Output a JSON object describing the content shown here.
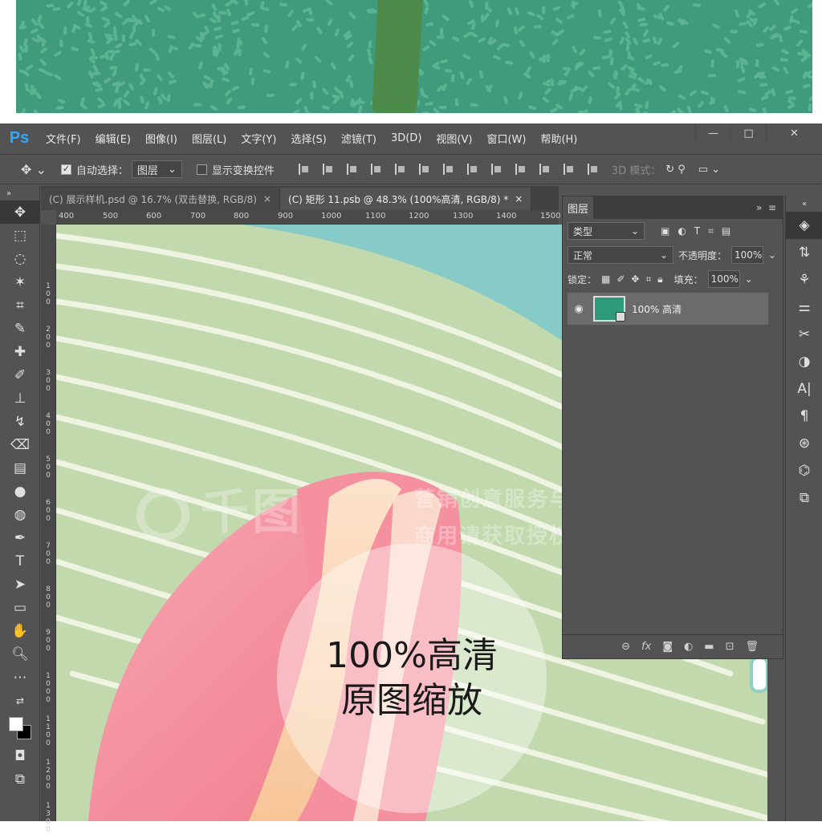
{
  "app": {
    "logo": "Ps"
  },
  "menu": [
    "文件(F)",
    "编辑(E)",
    "图像(I)",
    "图层(L)",
    "文字(Y)",
    "选择(S)",
    "滤镜(T)",
    "3D(D)",
    "视图(V)",
    "窗口(W)",
    "帮助(H)"
  ],
  "window_controls": {
    "minimize": "—",
    "maximize": "□",
    "close": "✕"
  },
  "options_bar": {
    "auto_select_label": "自动选择：",
    "auto_select_value": "图层",
    "show_transform_label": "显示变换控件",
    "mode_3d_label": "3D 模式："
  },
  "tabs": [
    {
      "label": "(C) 展示样机.psd @ 16.7% (双击替换, RGB/8)",
      "close": "×"
    },
    {
      "label": "(C) 矩形 11.psb @ 48.3% (100%高清, RGB/8) *",
      "close": "×"
    }
  ],
  "ruler_h": [
    "400",
    "500",
    "600",
    "700",
    "800",
    "900",
    "1000",
    "1100",
    "1200",
    "1300",
    "1400",
    "1500"
  ],
  "ruler_v": [
    "1\n0\n0",
    "2\n0\n0",
    "3\n0\n0",
    "4\n0\n0",
    "5\n0\n0",
    "6\n0\n0",
    "7\n0\n0",
    "8\n0\n0",
    "9\n0\n0",
    "1\n0\n0\n0",
    "1\n1\n0\n0",
    "1\n2\n0\n0",
    "1\n3\n0\n0"
  ],
  "canvas": {
    "watermark_brand": "千图",
    "watermark_line1": "营销创意服务与协作平台",
    "watermark_line2": "商用请获取授权",
    "zoom_line1": "100%高清",
    "zoom_line2": "原图缩放"
  },
  "layers_panel": {
    "title": "图层",
    "filter_value": "类型",
    "blend_mode": "正常",
    "opacity_label": "不透明度：",
    "opacity_value": "100%",
    "lock_label": "锁定：",
    "fill_label": "填充：",
    "fill_value": "100%",
    "layers": [
      {
        "name": "100% 高清",
        "visible": true
      }
    ],
    "footer_icons": [
      "link-icon",
      "fx-icon",
      "mask-icon",
      "adjustment-icon",
      "folder-icon",
      "new-layer-icon",
      "trash-icon"
    ]
  },
  "colors": {
    "ps_blue": "#31a8ff",
    "panel_bg": "#535353",
    "layer_thumb": "#2d9a7c",
    "canvas_green": "#c2d9ae",
    "canvas_teal": "#86cbc7",
    "flower_pink": "#f28b9c"
  }
}
